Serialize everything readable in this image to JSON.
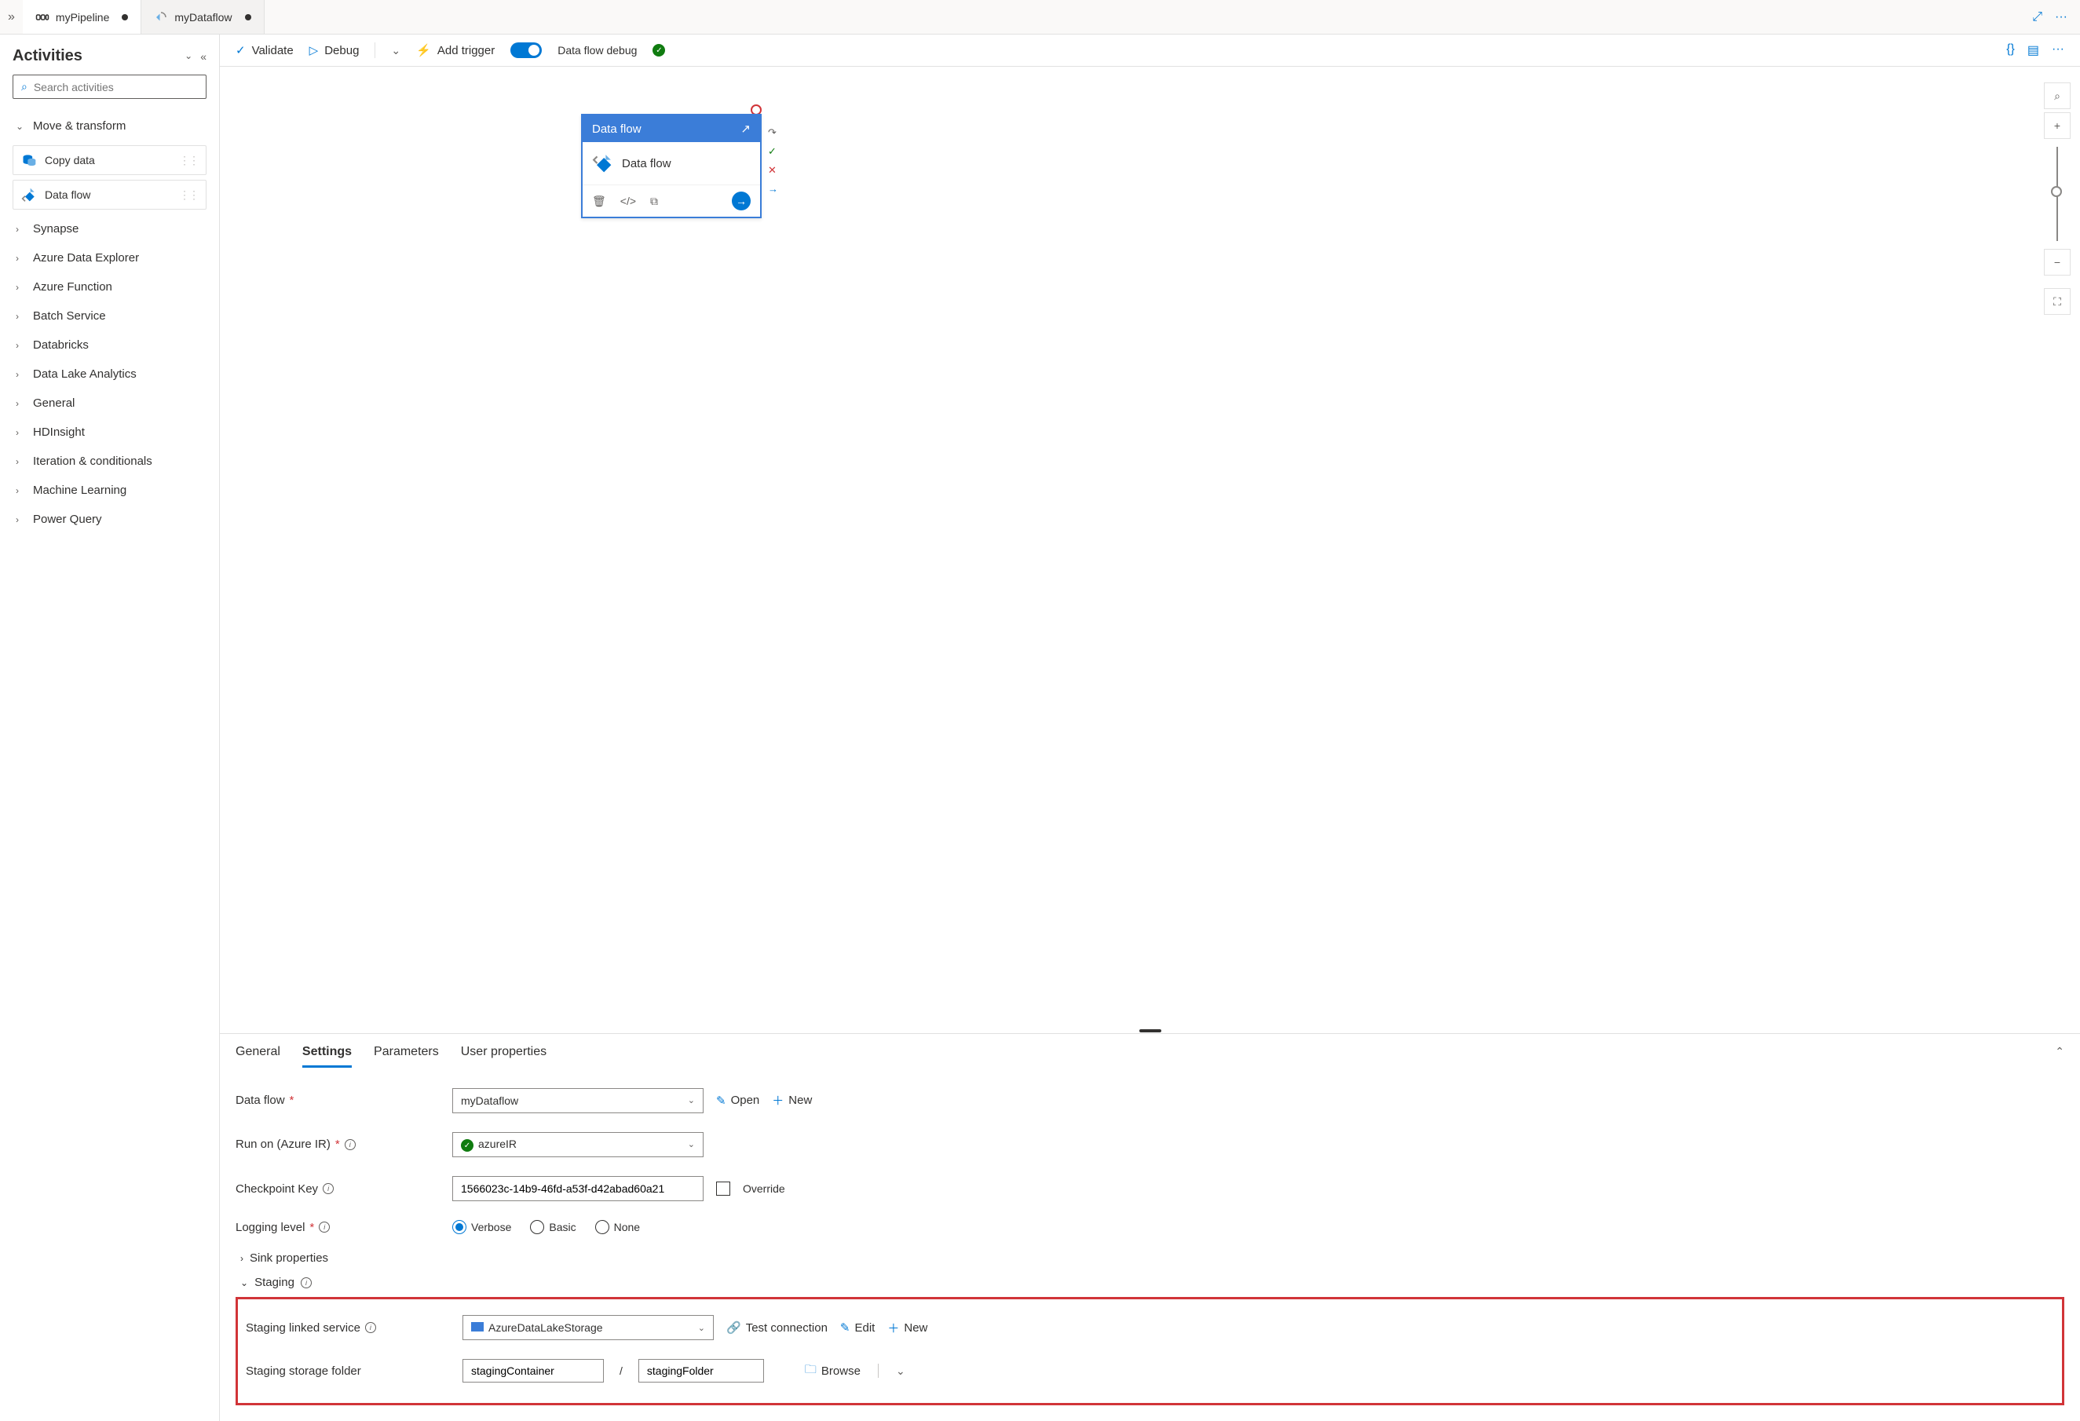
{
  "tabs": [
    {
      "title": "myPipeline",
      "dirty": true,
      "active": true
    },
    {
      "title": "myDataflow",
      "dirty": true,
      "active": false
    }
  ],
  "sidebar": {
    "title": "Activities",
    "search_placeholder": "Search activities",
    "categories": {
      "move_transform": "Move & transform",
      "copy_data": "Copy data",
      "data_flow": "Data flow",
      "synapse": "Synapse",
      "azure_data_explorer": "Azure Data Explorer",
      "azure_function": "Azure Function",
      "batch_service": "Batch Service",
      "databricks": "Databricks",
      "data_lake_analytics": "Data Lake Analytics",
      "general": "General",
      "hdinsight": "HDInsight",
      "iteration_conditionals": "Iteration & conditionals",
      "machine_learning": "Machine Learning",
      "power_query": "Power Query"
    }
  },
  "toolbar": {
    "validate": "Validate",
    "debug": "Debug",
    "add_trigger": "Add trigger",
    "data_flow_debug": "Data flow debug"
  },
  "canvas_node": {
    "type": "Data flow",
    "name": "Data flow"
  },
  "panel": {
    "tabs": {
      "general": "General",
      "settings": "Settings",
      "parameters": "Parameters",
      "user_properties": "User properties"
    },
    "labels": {
      "data_flow": "Data flow",
      "run_on": "Run on (Azure IR)",
      "checkpoint_key": "Checkpoint Key",
      "logging_level": "Logging level",
      "sink_properties": "Sink properties",
      "staging": "Staging",
      "staging_linked_service": "Staging linked service",
      "staging_storage_folder": "Staging storage folder"
    },
    "values": {
      "data_flow": "myDataflow",
      "run_on": "azureIR",
      "checkpoint_key": "1566023c-14b9-46fd-a53f-d42abad60a21",
      "override": "Override",
      "staging_linked_service": "AzureDataLakeStorage",
      "staging_container": "stagingContainer",
      "staging_folder": "stagingFolder"
    },
    "logging_options": {
      "verbose": "Verbose",
      "basic": "Basic",
      "none": "None"
    },
    "actions": {
      "open": "Open",
      "new": "New",
      "test_connection": "Test connection",
      "edit": "Edit",
      "browse": "Browse"
    }
  }
}
